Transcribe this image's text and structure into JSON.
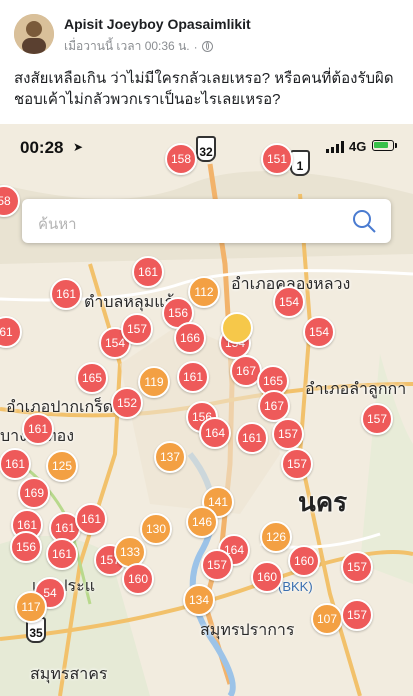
{
  "post": {
    "author": "Apisit Joeyboy Opasaimlikit",
    "time": "เมื่อวานนี้ เวลา 00:36 น.",
    "separator": "·",
    "text": "สงสัยเหลือเกิน ว่าไม่มีใครกลัวเลยเหรอ? หรือคนที่ต้องรับผิดชอบเค้าไม่กลัวพวกเราเป็นอะไรเลยเหรอ?"
  },
  "phone": {
    "time": "00:28",
    "network": "4G",
    "battery_level": 0.7
  },
  "search": {
    "placeholder": "ค้นหา"
  },
  "map": {
    "places": [
      "อำเภอคลองหลวง",
      "ตำบลหลุมแก้",
      "อำเภอลำลูกกา",
      "อำเภอปากเกร็ด",
      "บางบัวทอง",
      "นคร",
      "เขาประแ",
      "สมุทรปราการ",
      "สมุทรสาคร",
      "(BKK)"
    ],
    "road_shields": [
      "32",
      "1",
      "35"
    ]
  },
  "colors": {
    "red": "#ee5a5a",
    "orange": "#f3a043",
    "yellow": "#f6c84a"
  },
  "markers": [
    {
      "v": "158",
      "c": "red"
    },
    {
      "v": "151",
      "c": "red"
    },
    {
      "v": "58",
      "c": "red"
    },
    {
      "v": "161",
      "c": "red"
    },
    {
      "v": "161",
      "c": "red"
    },
    {
      "v": "112",
      "c": "orange"
    },
    {
      "v": "154",
      "c": "red"
    },
    {
      "v": "61",
      "c": "red"
    },
    {
      "v": "156",
      "c": "red"
    },
    {
      "v": "154",
      "c": "red"
    },
    {
      "v": "154",
      "c": "red"
    },
    {
      "v": "154",
      "c": "red"
    },
    {
      "v": "157",
      "c": "red"
    },
    {
      "v": "166",
      "c": "red"
    },
    {
      "v": "",
      "c": "yellow"
    },
    {
      "v": "165",
      "c": "red"
    },
    {
      "v": "119",
      "c": "orange"
    },
    {
      "v": "161",
      "c": "red"
    },
    {
      "v": "167",
      "c": "red"
    },
    {
      "v": "165",
      "c": "red"
    },
    {
      "v": "152",
      "c": "red"
    },
    {
      "v": "156",
      "c": "red"
    },
    {
      "v": "167",
      "c": "red"
    },
    {
      "v": "157",
      "c": "red"
    },
    {
      "v": "161",
      "c": "red"
    },
    {
      "v": "164",
      "c": "red"
    },
    {
      "v": "161",
      "c": "red"
    },
    {
      "v": "157",
      "c": "red"
    },
    {
      "v": "161",
      "c": "red"
    },
    {
      "v": "125",
      "c": "orange"
    },
    {
      "v": "137",
      "c": "orange"
    },
    {
      "v": "157",
      "c": "red"
    },
    {
      "v": "169",
      "c": "red"
    },
    {
      "v": "141",
      "c": "orange"
    },
    {
      "v": "161",
      "c": "red"
    },
    {
      "v": "161",
      "c": "red"
    },
    {
      "v": "161",
      "c": "red"
    },
    {
      "v": "130",
      "c": "orange"
    },
    {
      "v": "146",
      "c": "orange"
    },
    {
      "v": "126",
      "c": "orange"
    },
    {
      "v": "156",
      "c": "red"
    },
    {
      "v": "161",
      "c": "red"
    },
    {
      "v": "157",
      "c": "red"
    },
    {
      "v": "133",
      "c": "orange"
    },
    {
      "v": "164",
      "c": "red"
    },
    {
      "v": "157",
      "c": "red"
    },
    {
      "v": "160",
      "c": "red"
    },
    {
      "v": "157",
      "c": "red"
    },
    {
      "v": "160",
      "c": "red"
    },
    {
      "v": "160",
      "c": "red"
    },
    {
      "v": "54",
      "c": "red"
    },
    {
      "v": "117",
      "c": "orange"
    },
    {
      "v": "134",
      "c": "orange"
    },
    {
      "v": "107",
      "c": "orange"
    },
    {
      "v": "157",
      "c": "red"
    }
  ]
}
